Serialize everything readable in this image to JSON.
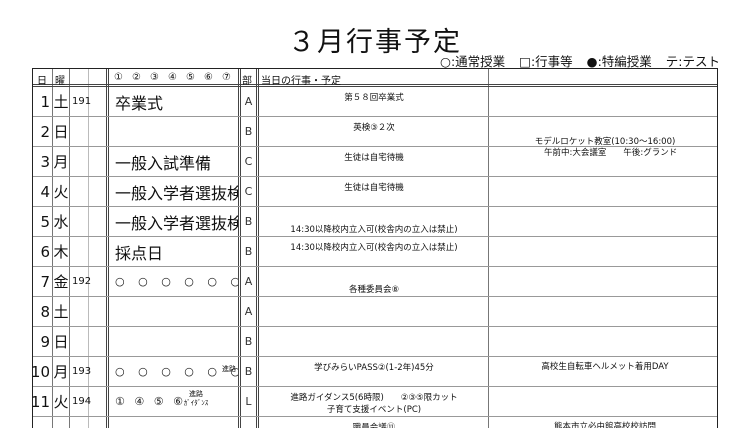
{
  "title": "３月行事予定",
  "legend": [
    "○:通常授業",
    "□:行事等",
    "●:特編授業",
    "テ:テスト"
  ],
  "header": {
    "day": "日",
    "weekday": "曜",
    "periods": [
      "①",
      "②",
      "③",
      "④",
      "⑤",
      "⑥",
      "⑦"
    ],
    "bu": "部",
    "events": "当日の行事・予定"
  },
  "rows": [
    {
      "day": "1",
      "wd": "土",
      "no": "191",
      "event": "卒業式",
      "bu": "A",
      "d1": [
        "第５８回卒業式"
      ],
      "d2": []
    },
    {
      "day": "2",
      "wd": "日",
      "no": "",
      "event": "",
      "bu": "B",
      "d1": [
        "英検③２次"
      ],
      "d2": [
        "モデルロケット教室(10:30〜16:00)",
        "　 午前中:大会議室　　午後:グランド"
      ]
    },
    {
      "day": "3",
      "wd": "月",
      "no": "",
      "event": "一般入試準備",
      "bu": "C",
      "d1": [
        "生徒は自宅待機"
      ],
      "d2": []
    },
    {
      "day": "4",
      "wd": "火",
      "no": "",
      "event": "一般入学者選抜検査",
      "bu": "C",
      "d1": [
        "生徒は自宅待機"
      ],
      "d2": []
    },
    {
      "day": "5",
      "wd": "水",
      "no": "",
      "event": "一般入学者選抜検査",
      "bu": "B",
      "d1": [
        "",
        "14:30以降校内立入可(校舎内の立入は禁止)"
      ],
      "d2": []
    },
    {
      "day": "6",
      "wd": "木",
      "no": "",
      "event": "採点日",
      "bu": "B",
      "d1": [
        "14:30以降校内立入可(校舎内の立入は禁止)"
      ],
      "d2": []
    },
    {
      "day": "7",
      "wd": "金",
      "no": "192",
      "event": "○ ○ ○ ○ ○ ○",
      "bu": "A",
      "d1": [
        "",
        "各種委員会⑧"
      ],
      "d2": []
    },
    {
      "day": "8",
      "wd": "土",
      "no": "",
      "event": "",
      "bu": "A",
      "d1": [],
      "d2": []
    },
    {
      "day": "9",
      "wd": "日",
      "no": "",
      "event": "",
      "bu": "B",
      "d1": [],
      "d2": []
    },
    {
      "day": "10",
      "wd": "月",
      "no": "193",
      "event": "○ ○ ○ ○ ○ ○",
      "bu": "B",
      "d1": [
        "学びみらいPASS②(1-2年)45分"
      ],
      "d2": [
        "高校生自転車ヘルメット着用DAY"
      ]
    },
    {
      "day": "11",
      "wd": "火",
      "no": "194",
      "event": "① ④ ⑤ ⑥",
      "bu": "L",
      "d1": [
        "進路ガイダンス5(6時限)　　②③⑤限カット",
        "子育て支援イベント(PC)"
      ],
      "d2": []
    },
    {
      "day": "",
      "wd": "",
      "no": "",
      "event": "",
      "bu": "",
      "d1": [
        "職員会議⑪"
      ],
      "d2": [
        "熊本市立必由館高校校訪問"
      ]
    }
  ],
  "shinro_label": "進路",
  "guidance_label": "ｶﾞｲﾀﾞﾝｽ"
}
